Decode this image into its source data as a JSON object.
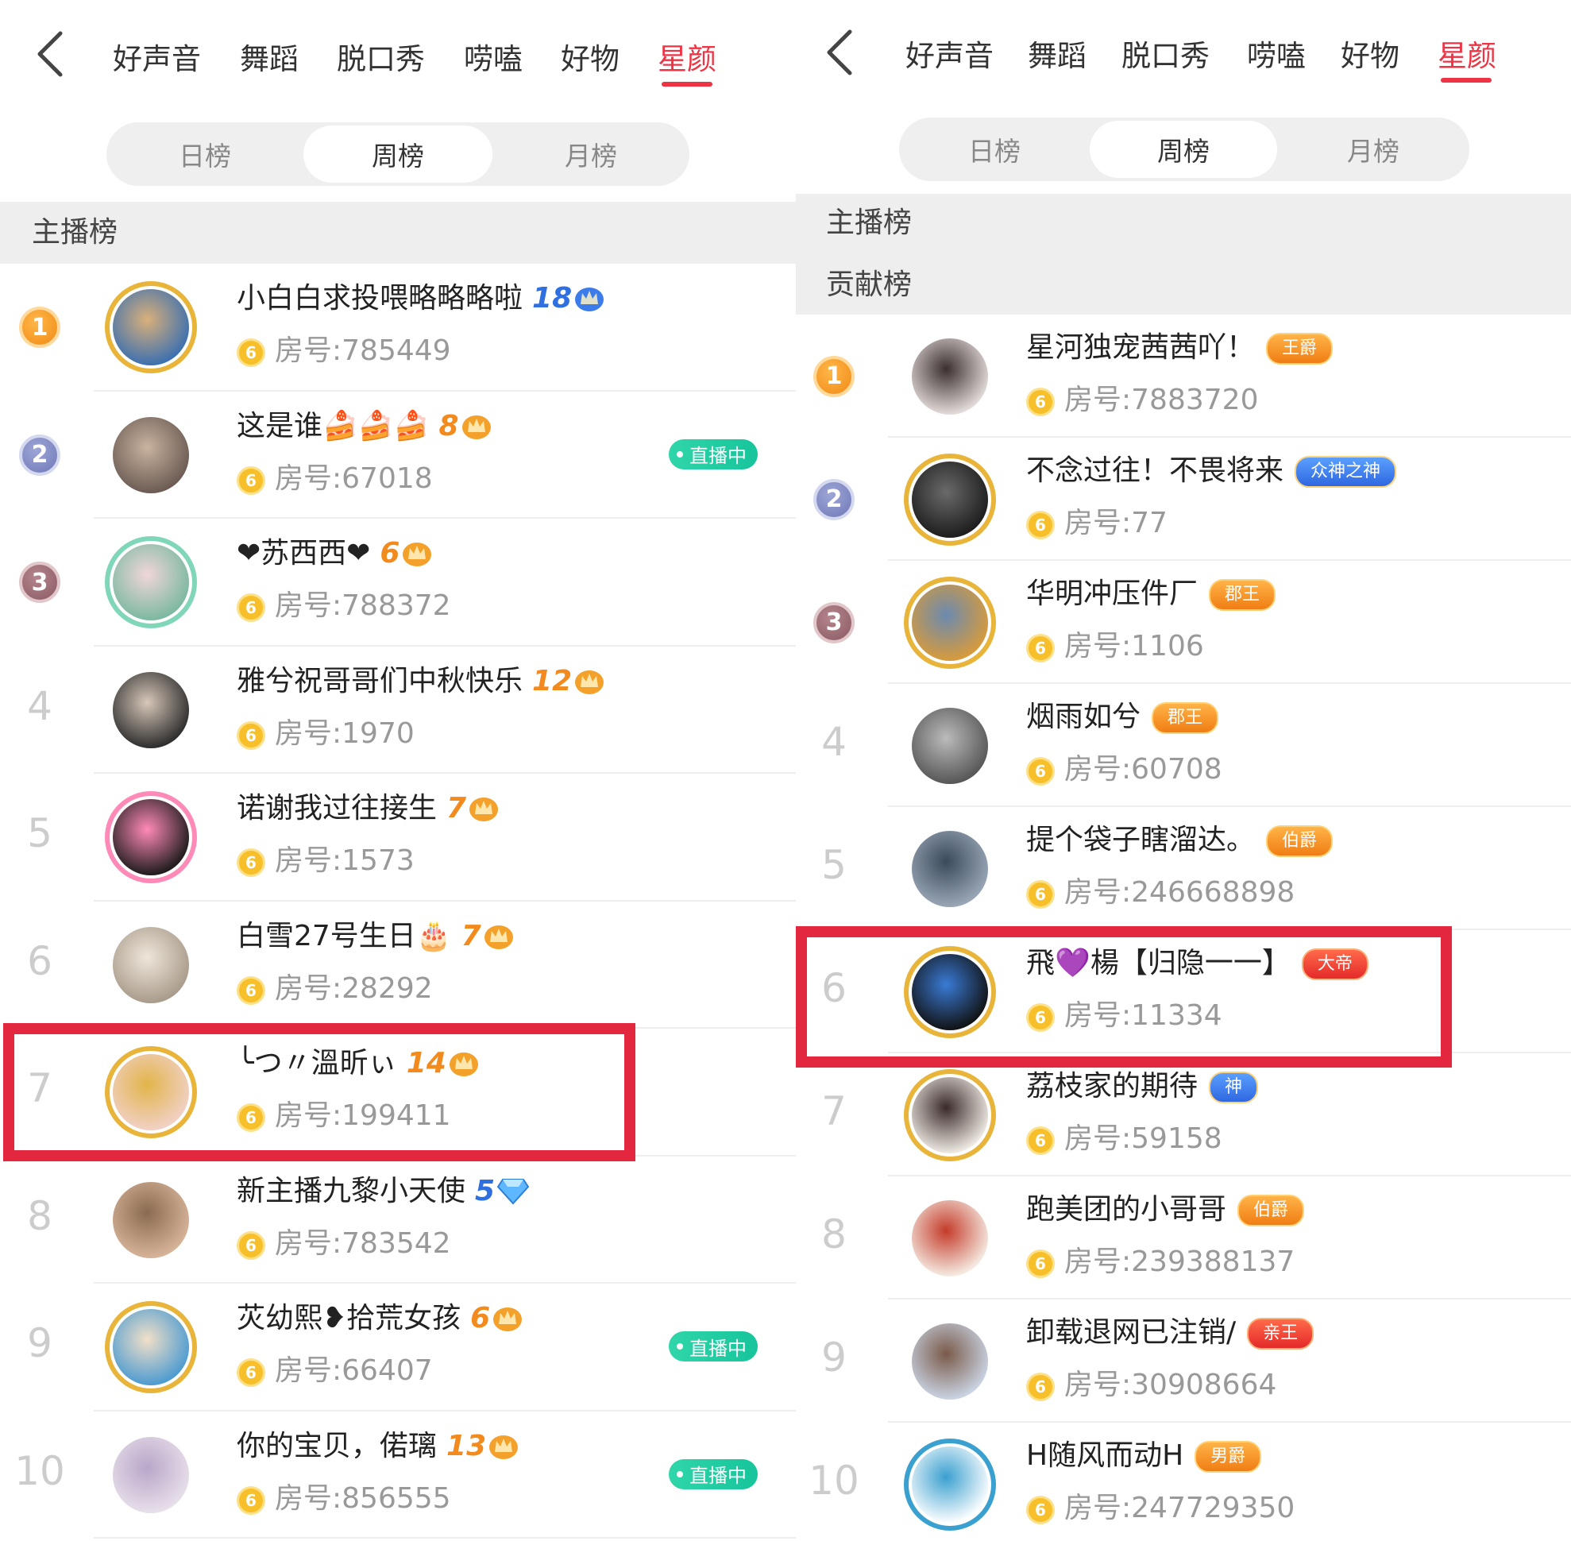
{
  "colors": {
    "accent": "#ee3344",
    "highlight": "#e3273e",
    "live": "#1fcfa2",
    "coin": "#f7c02a"
  },
  "left": {
    "nav": {
      "tabs": [
        "好声音",
        "舞蹈",
        "脱口秀",
        "唠嗑",
        "好物",
        "星颜"
      ],
      "active": "星颜"
    },
    "periods": [
      "日榜",
      "周榜",
      "月榜"
    ],
    "active_period": "周榜",
    "sections": [
      "主播榜"
    ],
    "room_prefix": "房号:",
    "live_label": "直播中",
    "rows": [
      {
        "rank": "1",
        "name": "小白白求投喂略略略啦",
        "level": "18",
        "level_icon": "crown-blue",
        "room": "785449",
        "live": false
      },
      {
        "rank": "2",
        "name": "这是谁🍰🍰🍰",
        "level": "8",
        "level_icon": "crown",
        "room": "67018",
        "live": true
      },
      {
        "rank": "3",
        "name": "❤苏西西❤",
        "level": "6",
        "level_icon": "crown",
        "room": "788372",
        "live": false
      },
      {
        "rank": "4",
        "name": "雅兮祝哥哥们中秋快乐",
        "level": "12",
        "level_icon": "crown",
        "room": "1970",
        "live": false
      },
      {
        "rank": "5",
        "name": "诺谢我过往接生",
        "level": "7",
        "level_icon": "crown",
        "room": "1573",
        "live": false
      },
      {
        "rank": "6",
        "name": "白雪27号生日🎂",
        "level": "7",
        "level_icon": "crown",
        "room": "28292",
        "live": false
      },
      {
        "rank": "7",
        "name": "╰つ〃溫昕ぃ",
        "level": "14",
        "level_icon": "crown",
        "room": "199411",
        "live": false
      },
      {
        "rank": "8",
        "name": "新主播九黎小天使",
        "level": "5",
        "level_icon": "diamond",
        "room": "783542",
        "live": false
      },
      {
        "rank": "9",
        "name": "苂幼熙❥拾荒女孩",
        "level": "6",
        "level_icon": "crown",
        "room": "66407",
        "live": true
      },
      {
        "rank": "10",
        "name": "你的宝贝，偌璃",
        "level": "13",
        "level_icon": "crown",
        "room": "856555",
        "live": true
      }
    ]
  },
  "right": {
    "nav": {
      "tabs": [
        "好声音",
        "舞蹈",
        "脱口秀",
        "唠嗑",
        "好物",
        "星颜"
      ],
      "active": "星颜"
    },
    "periods": [
      "日榜",
      "周榜",
      "月榜"
    ],
    "active_period": "周榜",
    "sections": [
      "主播榜",
      "贡献榜"
    ],
    "room_prefix": "房号:",
    "rows": [
      {
        "rank": "1",
        "name": "星河独宠茜茜吖！",
        "badge": "王爵",
        "badge_color": "orange",
        "room": "7883720"
      },
      {
        "rank": "2",
        "name": "不念过往！不畏将来",
        "badge": "众神之神",
        "badge_color": "blue",
        "room": "77"
      },
      {
        "rank": "3",
        "name": "华明冲压件厂",
        "badge": "郡王",
        "badge_color": "orange",
        "room": "1106"
      },
      {
        "rank": "4",
        "name": "烟雨如兮",
        "badge": "郡王",
        "badge_color": "orange",
        "room": "60708"
      },
      {
        "rank": "5",
        "name": "提个袋子瞎溜达。",
        "badge": "伯爵",
        "badge_color": "orange",
        "room": "246668898"
      },
      {
        "rank": "6",
        "name": "飛💜楊【归隐一一】",
        "badge": "大帝",
        "badge_color": "red",
        "room": "11334"
      },
      {
        "rank": "7",
        "name": "荔枝家的期待",
        "badge": "神",
        "badge_color": "blue",
        "room": "59158"
      },
      {
        "rank": "8",
        "name": "跑美团的小哥哥",
        "badge": "伯爵",
        "badge_color": "orange",
        "room": "239388137"
      },
      {
        "rank": "9",
        "name": "卸载退网已注销/",
        "badge": "亲王",
        "badge_color": "red",
        "room": "30908664"
      },
      {
        "rank": "10",
        "name": "H随风而动H",
        "badge": "男爵",
        "badge_color": "orange",
        "room": "247729350"
      }
    ]
  }
}
